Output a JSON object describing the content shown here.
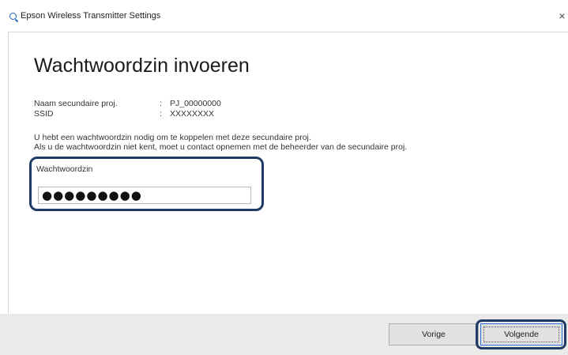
{
  "window": {
    "title": "Epson Wireless Transmitter Settings",
    "close_symbol": "×"
  },
  "dialog": {
    "heading": "Wachtwoordzin invoeren",
    "info": [
      {
        "label": "Naam secundaire proj.",
        "colon": ":",
        "value": "PJ_00000000"
      },
      {
        "label": "SSID",
        "colon": ":",
        "value": "XXXXXXXX"
      }
    ],
    "paragraph_lines": [
      "U hebt een wachtwoordzin nodig om te koppelen met deze secundaire proj.",
      "Als u de wachtwoordzin niet kent, moet u contact opnemen met de beheerder van de secundaire proj."
    ],
    "passphrase": {
      "label": "Wachtwoordzin",
      "value": "●●●●●●●●●"
    }
  },
  "footer": {
    "back_label": "Vorige",
    "next_label": "Volgende"
  },
  "icons": {
    "app": "app-icon",
    "close": "close-icon"
  },
  "colors": {
    "highlight_border": "#1f3b63",
    "focus_accent": "#2a6fd6"
  }
}
